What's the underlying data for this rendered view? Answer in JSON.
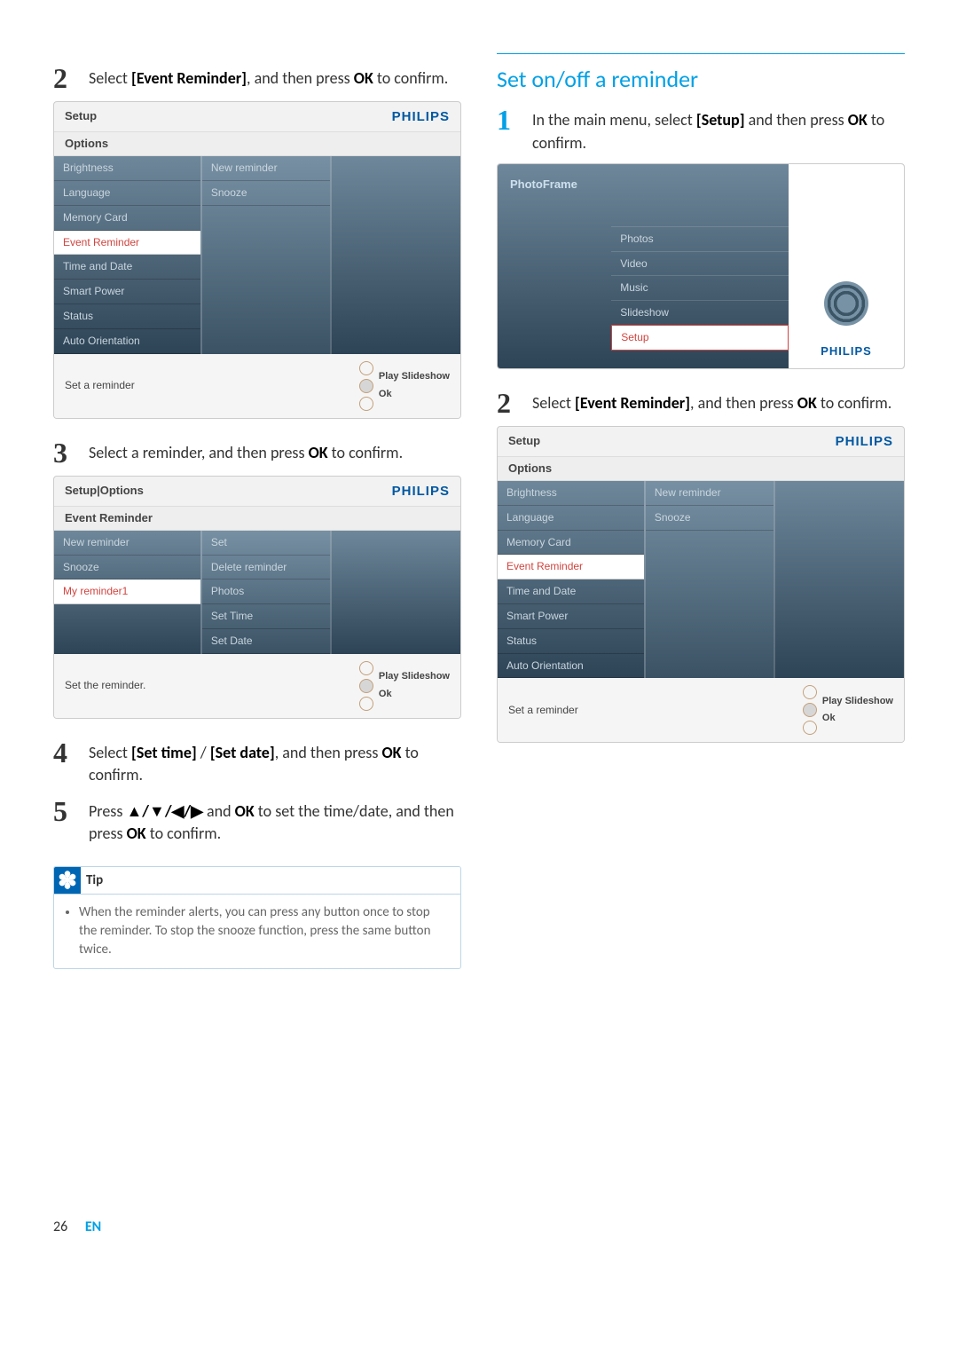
{
  "steps_left": {
    "s2": {
      "num": "2",
      "text_pre": "Select ",
      "b1": "[Event Reminder]",
      "text_mid": ", and then press ",
      "b2": "OK",
      "text_post": " to confirm."
    },
    "s3": {
      "num": "3",
      "text_pre": "Select a reminder, and then press ",
      "b1": "OK",
      "text_post": " to confirm."
    },
    "s4": {
      "num": "4",
      "text_pre": "Select ",
      "b1": "[Set time]",
      "sep": " / ",
      "b2": "[Set date]",
      "text_mid": ", and then press ",
      "b3": "OK",
      "text_post": " to confirm."
    },
    "s5": {
      "num": "5",
      "text_pre": "Press ",
      "b1": "▲/▼/◀/▶",
      "text_mid_a": " and ",
      "b2": "OK",
      "text_mid_b": " to set the time/date, and then press ",
      "b3": "OK",
      "text_post": " to confirm."
    }
  },
  "screenshot_setup": {
    "title": "Setup",
    "brand": "PHILIPS",
    "options": "Options",
    "left_items": [
      "Brightness",
      "Language",
      "Memory Card",
      "Event Reminder",
      "Time and Date",
      "Smart Power",
      "Status",
      "Auto Orientation"
    ],
    "selected_index": 3,
    "mid_items": [
      "New reminder",
      "Snooze"
    ],
    "footer_left": "Set a reminder",
    "footer_btn1": "Play Slideshow",
    "footer_btn2": "Ok"
  },
  "screenshot_setupoptions": {
    "title": "Setup|Options",
    "brand": "PHILIPS",
    "sub": "Event Reminder",
    "left_items": [
      "New reminder",
      "Snooze",
      "My reminder1"
    ],
    "selected_index": 2,
    "mid_items": [
      "Set",
      "Delete reminder",
      "Photos",
      "Set Time",
      "Set Date"
    ],
    "footer_left": "Set the reminder.",
    "footer_btn1": "Play Slideshow",
    "footer_btn2": "Ok"
  },
  "tip": {
    "label": "Tip",
    "bullet": "When the reminder alerts, you can press any button once to stop the reminder. To stop the snooze function, press the same button twice."
  },
  "heading_right": "Set on/off a reminder",
  "steps_right": {
    "s1": {
      "num": "1",
      "text_pre": "In the main menu, select ",
      "b1": "[Setup]",
      "text_mid": " and then press ",
      "b2": "OK",
      "text_post": " to confirm."
    },
    "s2": {
      "num": "2",
      "text_pre": "Select ",
      "b1": "[Event Reminder]",
      "text_mid": ", and then press ",
      "b2": "OK",
      "text_post": " to confirm."
    }
  },
  "screenshot_photoframe": {
    "title": "PhotoFrame",
    "brand": "PHILIPS",
    "menu": [
      "Photos",
      "Video",
      "Music",
      "Slideshow",
      "Setup"
    ],
    "selected_index": 4
  },
  "footer": {
    "page": "26",
    "lang": "EN"
  }
}
